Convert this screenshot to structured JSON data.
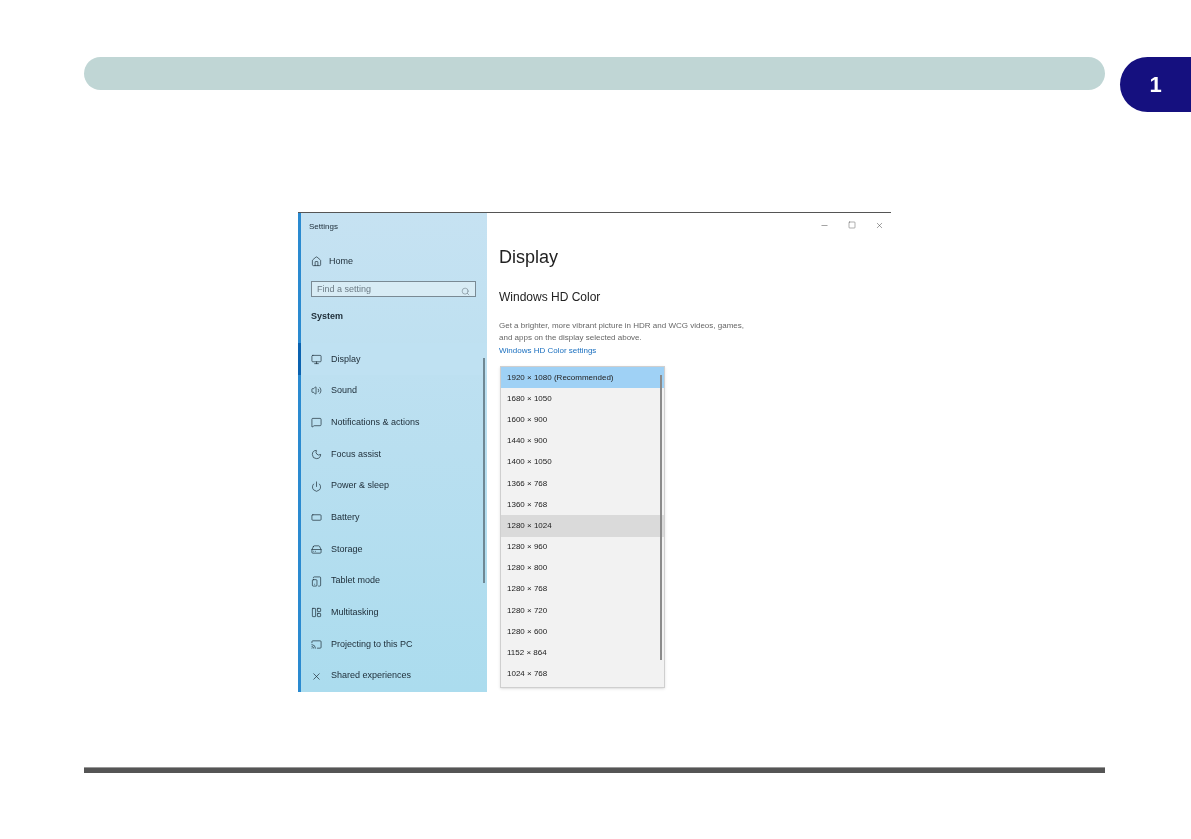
{
  "chapter_tab": "1",
  "window": {
    "title": "Settings"
  },
  "sidebar": {
    "home": "Home",
    "search": {
      "placeholder": "Find a setting"
    },
    "section": "System",
    "items": [
      {
        "label": "Display",
        "selected": true
      },
      {
        "label": "Sound",
        "selected": false
      },
      {
        "label": "Notifications & actions",
        "selected": false
      },
      {
        "label": "Focus assist",
        "selected": false
      },
      {
        "label": "Power & sleep",
        "selected": false
      },
      {
        "label": "Battery",
        "selected": false
      },
      {
        "label": "Storage",
        "selected": false
      },
      {
        "label": "Tablet mode",
        "selected": false
      },
      {
        "label": "Multitasking",
        "selected": false
      },
      {
        "label": "Projecting to this PC",
        "selected": false
      },
      {
        "label": "Shared experiences",
        "selected": false
      }
    ]
  },
  "main": {
    "title": "Display",
    "heading": "Windows HD Color",
    "description": "Get a brighter, more vibrant picture in HDR and WCG videos, games, and apps on the display selected above.",
    "link": "Windows HD Color settings"
  },
  "resolution_dropdown": {
    "options": [
      {
        "label": "1920 × 1080 (Recommended)",
        "selected": true,
        "hovered": false
      },
      {
        "label": "1680 × 1050",
        "selected": false,
        "hovered": false
      },
      {
        "label": "1600 × 900",
        "selected": false,
        "hovered": false
      },
      {
        "label": "1440 × 900",
        "selected": false,
        "hovered": false
      },
      {
        "label": "1400 × 1050",
        "selected": false,
        "hovered": false
      },
      {
        "label": "1366 × 768",
        "selected": false,
        "hovered": false
      },
      {
        "label": "1360 × 768",
        "selected": false,
        "hovered": false
      },
      {
        "label": "1280 × 1024",
        "selected": false,
        "hovered": true
      },
      {
        "label": "1280 × 960",
        "selected": false,
        "hovered": false
      },
      {
        "label": "1280 × 800",
        "selected": false,
        "hovered": false
      },
      {
        "label": "1280 × 768",
        "selected": false,
        "hovered": false
      },
      {
        "label": "1280 × 720",
        "selected": false,
        "hovered": false
      },
      {
        "label": "1280 × 600",
        "selected": false,
        "hovered": false
      },
      {
        "label": "1152 × 864",
        "selected": false,
        "hovered": false
      },
      {
        "label": "1024 × 768",
        "selected": false,
        "hovered": false
      }
    ]
  }
}
